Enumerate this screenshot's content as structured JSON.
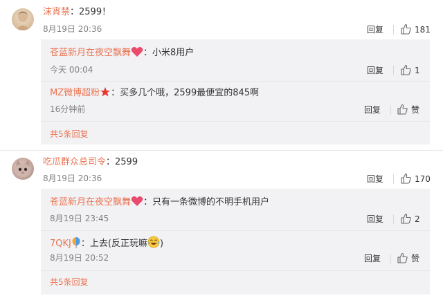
{
  "comments": [
    {
      "user": "沫宵禁",
      "text": "：2599！",
      "time": "8月19日 20:36",
      "reply": "回复",
      "likes": "181",
      "replies": [
        {
          "user": "苍蓝新月在夜空飘舞",
          "text": "：小米8用户",
          "time": "今天 00:04",
          "reply": "回复",
          "likes": "1"
        },
        {
          "user": "MZ微博超粉",
          "text": "：买多几个哦，2599最便宜的845啊",
          "time": "16分钟前",
          "reply": "回复",
          "likes": "赞"
        }
      ],
      "more": "共5条回复"
    },
    {
      "user": "吃瓜群众总司令",
      "text": "：2599",
      "time": "8月19日 20:36",
      "reply": "回复",
      "likes": "170",
      "replies": [
        {
          "user": "苍蓝新月在夜空飘舞",
          "text": "：只有一条微博的不明手机用户",
          "time": "8月19日 23:45",
          "reply": "回复",
          "likes": "2"
        },
        {
          "user": "7QKJ",
          "text": "：上去(反正玩嘛",
          "text_end": ")",
          "time": "8月19日 20:52",
          "reply": "回复",
          "likes": "赞"
        }
      ],
      "more": "共5条回复"
    }
  ],
  "colors": {
    "username": "#eb7350",
    "subbox": "#f2f2f5",
    "link": "#4e6ea5"
  },
  "icons": [
    "thumbs-up-icon",
    "heart-badge-icon",
    "star-badge-icon",
    "balloon-badge-icon",
    "laughing-crying-emoji-icon"
  ]
}
